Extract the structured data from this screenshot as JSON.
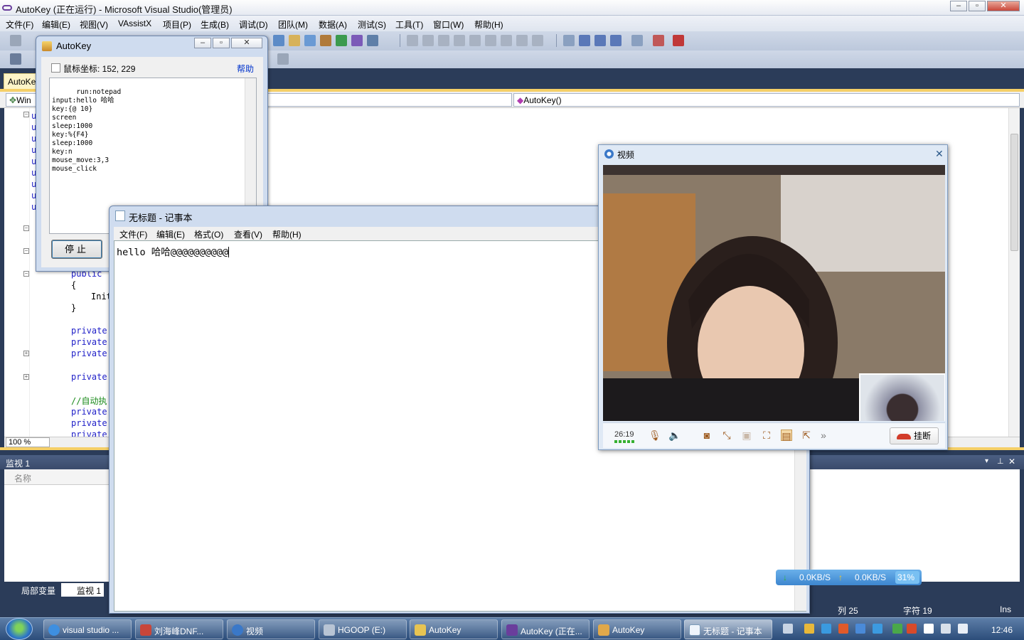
{
  "vs": {
    "title": "AutoKey (正在运行) - Microsoft Visual Studio(管理员)",
    "menu": [
      "文件(F)",
      "编辑(E)",
      "视图(V)",
      "VAssistX",
      "项目(P)",
      "生成(B)",
      "调试(D)",
      "团队(M)",
      "数据(A)",
      "测试(S)",
      "工具(T)",
      "窗口(W)",
      "帮助(H)"
    ],
    "doc_tab": "AutoKe",
    "nav_left": "Win",
    "nav_right": "AutoKey()",
    "code": {
      "public_1": "public",
      "brace_open": "{",
      "init": "Init",
      "brace_close": "}",
      "p1": "private",
      "p2": "private",
      "p3": "private",
      "p4": "private",
      "comment": "//自动执",
      "p5": "private",
      "p6": "private",
      "p7": "private"
    },
    "zoom": "100 %",
    "watch_title": "监视 1",
    "watch_col_name": "名称",
    "tab_locals": "局部变量",
    "tab_watch": "监视 1",
    "status_col": "列 25",
    "status_char": "字符 19",
    "status_ins": "Ins"
  },
  "autokey": {
    "title": "AutoKey",
    "coord_label": "鼠标坐标: 152, 229",
    "help": "帮助",
    "script": "run:notepad\ninput:hello 哈哈\nkey:{@ 10}\nscreen\nsleep:1000\nkey:%{F4}\nsleep:1000\nkey:n\nmouse_move:3,3\nmouse_click",
    "stop": "停止"
  },
  "notepad": {
    "title": "无标题 - 记事本",
    "menu": [
      "文件(F)",
      "编辑(E)",
      "格式(O)",
      "查看(V)",
      "帮助(H)"
    ],
    "text": "hello 哈哈@@@@@@@@@@"
  },
  "video": {
    "title": "视频",
    "timer": "26:19",
    "hangup": "挂断",
    "more": "»"
  },
  "net": {
    "down": "0.0KB/S",
    "up": "0.0KB/S",
    "pct": "31%"
  },
  "taskbar": {
    "items": [
      "visual studio ...",
      "刘海峰DNF...",
      "视频",
      "HGOOP (E:)",
      "AutoKey",
      "AutoKey (正在...",
      "AutoKey",
      "无标题 - 记事本"
    ],
    "clock": "12:46"
  }
}
